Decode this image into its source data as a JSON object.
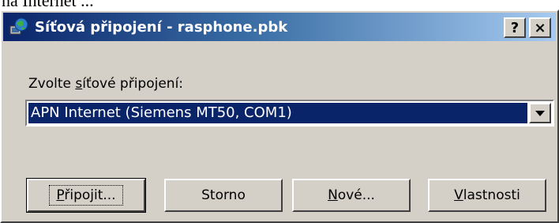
{
  "background_text": "na Internet ...",
  "window": {
    "title": "Síťová připojení - rasphone.pbk",
    "title_icon": "network-globe-icon",
    "help_button": "?",
    "close_button": "×"
  },
  "connection": {
    "label_prefix": "Zvolte ",
    "label_underlined": "s",
    "label_rest": "íťové připojení:",
    "selected": "APN Internet (Siemens MT50, COM1)"
  },
  "buttons": {
    "connect": {
      "u": "P",
      "rest": "řipojit..."
    },
    "cancel": "Storno",
    "new": {
      "u": "N",
      "rest": "ové..."
    },
    "properties": {
      "u": "V",
      "rest": "lastnosti"
    }
  },
  "colors": {
    "titlebar_start": "#0a246a",
    "titlebar_end": "#a6caf0",
    "selection": "#0a246a",
    "face": "#d4d0c8"
  }
}
